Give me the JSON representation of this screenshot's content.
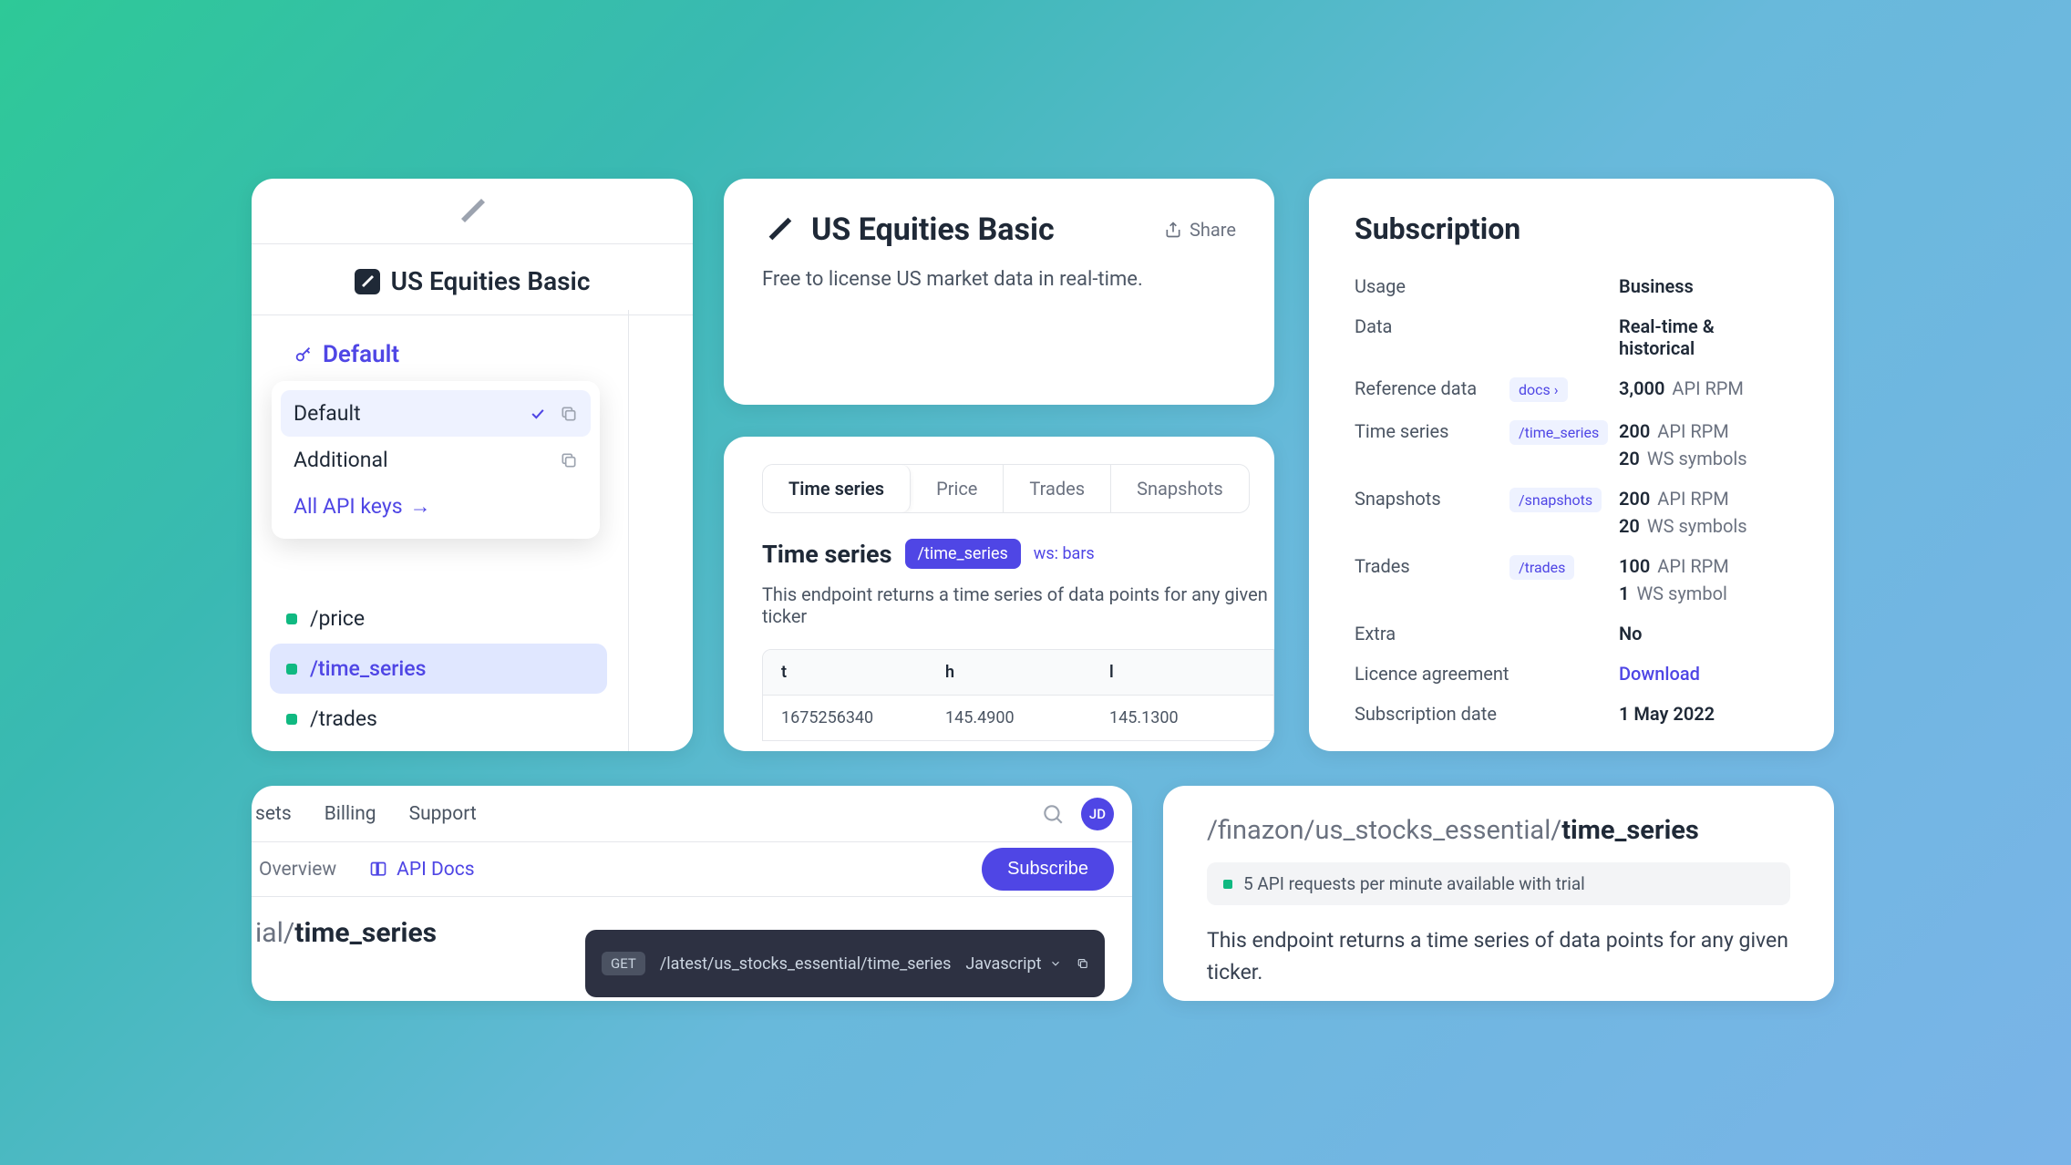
{
  "card1": {
    "title": "US Equities Basic",
    "key_label": "Default",
    "dropdown": {
      "items": [
        {
          "label": "Default",
          "selected": true
        },
        {
          "label": "Additional",
          "selected": false
        }
      ],
      "all_link": "All API keys"
    },
    "endpoints": [
      {
        "label": "/price",
        "active": false
      },
      {
        "label": "/time_series",
        "active": true
      },
      {
        "label": "/trades",
        "active": false
      }
    ]
  },
  "card2": {
    "title": "US Equities Basic",
    "share": "Share",
    "description": "Free to license US market data in real-time."
  },
  "card3": {
    "title": "Subscription",
    "rows": {
      "usage": {
        "label": "Usage",
        "value": "Business"
      },
      "data": {
        "label": "Data",
        "value": "Real-time & historical"
      },
      "reference": {
        "label": "Reference data",
        "chip": "docs",
        "v1": "3,000",
        "u1": "API RPM"
      },
      "timeseries": {
        "label": "Time series",
        "chip": "/time_series",
        "v1": "200",
        "u1": "API RPM",
        "v2": "20",
        "u2": "WS symbols"
      },
      "snapshots": {
        "label": "Snapshots",
        "chip": "/snapshots",
        "v1": "200",
        "u1": "API RPM",
        "v2": "20",
        "u2": "WS symbols"
      },
      "trades": {
        "label": "Trades",
        "chip": "/trades",
        "v1": "100",
        "u1": "API RPM",
        "v2": "1",
        "u2": "WS symbol"
      },
      "extra": {
        "label": "Extra",
        "value": "No"
      },
      "licence": {
        "label": "Licence agreement",
        "value": "Download"
      },
      "subdate": {
        "label": "Subscription date",
        "value": "1 May 2022"
      }
    }
  },
  "card4": {
    "tabs": [
      "Time series",
      "Price",
      "Trades",
      "Snapshots"
    ],
    "title": "Time series",
    "pill": "/time_series",
    "ws": "ws: bars",
    "description": "This endpoint returns a time series of data points for any given ticker",
    "table": {
      "headers": [
        "t",
        "h",
        "l"
      ],
      "row": [
        "1675256340",
        "145.4900",
        "145.1300"
      ]
    }
  },
  "card5": {
    "nav": [
      "sets",
      "Billing",
      "Support"
    ],
    "avatar": "JD",
    "subnav": {
      "overview": "Overview",
      "apidocs": "API Docs"
    },
    "subscribe": "Subscribe",
    "breadcrumb": {
      "prefix": "ial/",
      "bold": "time_series"
    },
    "code": {
      "method": "GET",
      "path": "/latest/us_stocks_essential/time_series",
      "lang": "Javascript"
    }
  },
  "card6": {
    "path": {
      "prefix": "/finazon/us_stocks_essential/",
      "bold": "time_series"
    },
    "banner": "5 API requests per minute available with trial",
    "description": "This endpoint returns a time series of data points for any given ticker."
  }
}
